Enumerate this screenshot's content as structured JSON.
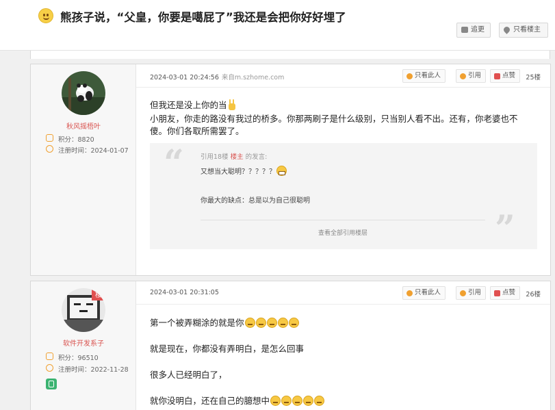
{
  "header": {
    "title": "熊孩子说，“父皇，你要是噶屁了”我还是会把你好好埋了",
    "btn_chase": "追更",
    "btn_only_op": "只看楼主"
  },
  "posts": [
    {
      "user": {
        "name": "秋风摇梧叶",
        "points": "积分：8820",
        "reg": "注册时间：2024-01-07"
      },
      "time": "2024-03-01 20:24:56",
      "source": "来自m.szhome.com",
      "actions": {
        "only": "只看此人",
        "quote": "引用",
        "like": "点赞"
      },
      "floor": "25楼",
      "lines": [
        "但我还是没上你的当",
        "小朋友，你走的路没有我过的桥多。你那两刷子是什么级别，只当别人看不出。还有，你老婆也不",
        "傻。你们各取所需罢了。"
      ],
      "quote": {
        "prefix": "引用18楼",
        "author": "楼主",
        "suffix": "的发言:",
        "line1": "又想当大聪明？？？？？",
        "line2": "你最大的缺点：总是以为自己很聪明",
        "view_all": "查看全部引用楼层"
      }
    },
    {
      "user": {
        "name": "软件开发系子",
        "points": "积分：96510",
        "reg": "注册时间：2022-11-28",
        "badge": "楼"
      },
      "time": "2024-03-01 20:31:05",
      "actions": {
        "only": "只看此人",
        "quote": "引用",
        "like": "点赞"
      },
      "floor": "26楼",
      "lines": [
        "第一个被弄糊涂的就是你",
        "就是现在，你都没有弄明白，是怎么回事",
        "很多人已经明白了，",
        "就你没明白，还在自己的臆想中"
      ]
    }
  ]
}
